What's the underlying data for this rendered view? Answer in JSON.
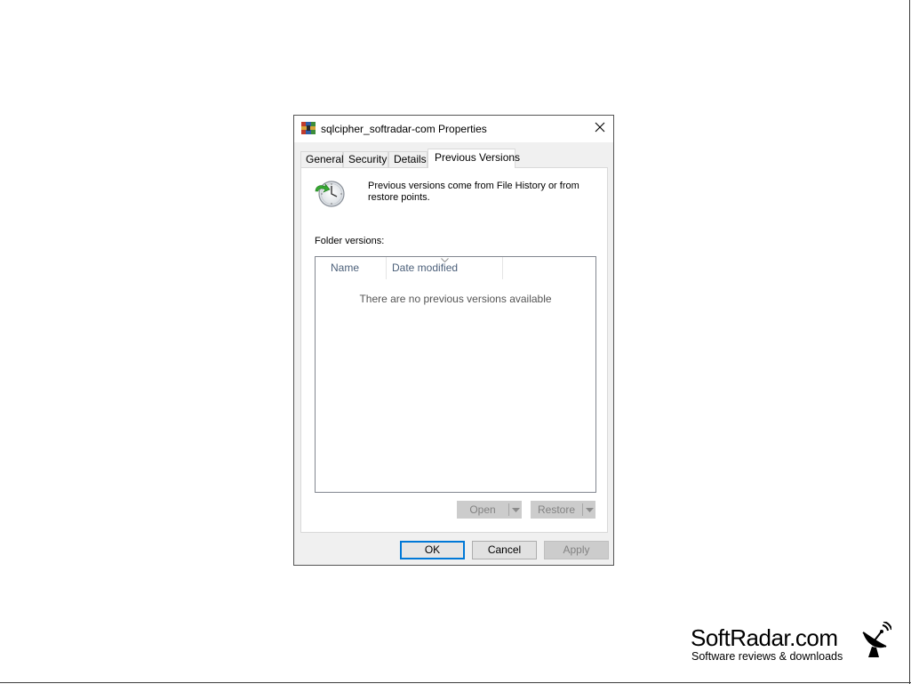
{
  "window": {
    "title": "sqlcipher_softradar-com Properties",
    "icon": "winrar-archive-icon",
    "close_icon": "close-icon"
  },
  "tabs": [
    {
      "label": "General",
      "active": false
    },
    {
      "label": "Security",
      "active": false
    },
    {
      "label": "Details",
      "active": false
    },
    {
      "label": "Previous Versions",
      "active": true
    }
  ],
  "previous_versions": {
    "icon": "clock-restore-icon",
    "info_text": "Previous versions come from File History or from restore points.",
    "folder_versions_label": "Folder versions:",
    "list": {
      "columns": [
        "Name",
        "Date modified"
      ],
      "sorted_column": "Date modified",
      "empty_message": "There are no previous versions available"
    },
    "open_button": "Open",
    "restore_button": "Restore"
  },
  "footer_buttons": {
    "ok": "OK",
    "cancel": "Cancel",
    "apply": "Apply"
  },
  "watermark": {
    "name": "SoftRadar.com",
    "tagline": "Software reviews & downloads",
    "icon": "satellite-dish-icon"
  },
  "colors": {
    "accent": "#0078d7",
    "disabled_text": "#838383",
    "header_text": "#4c607a"
  }
}
